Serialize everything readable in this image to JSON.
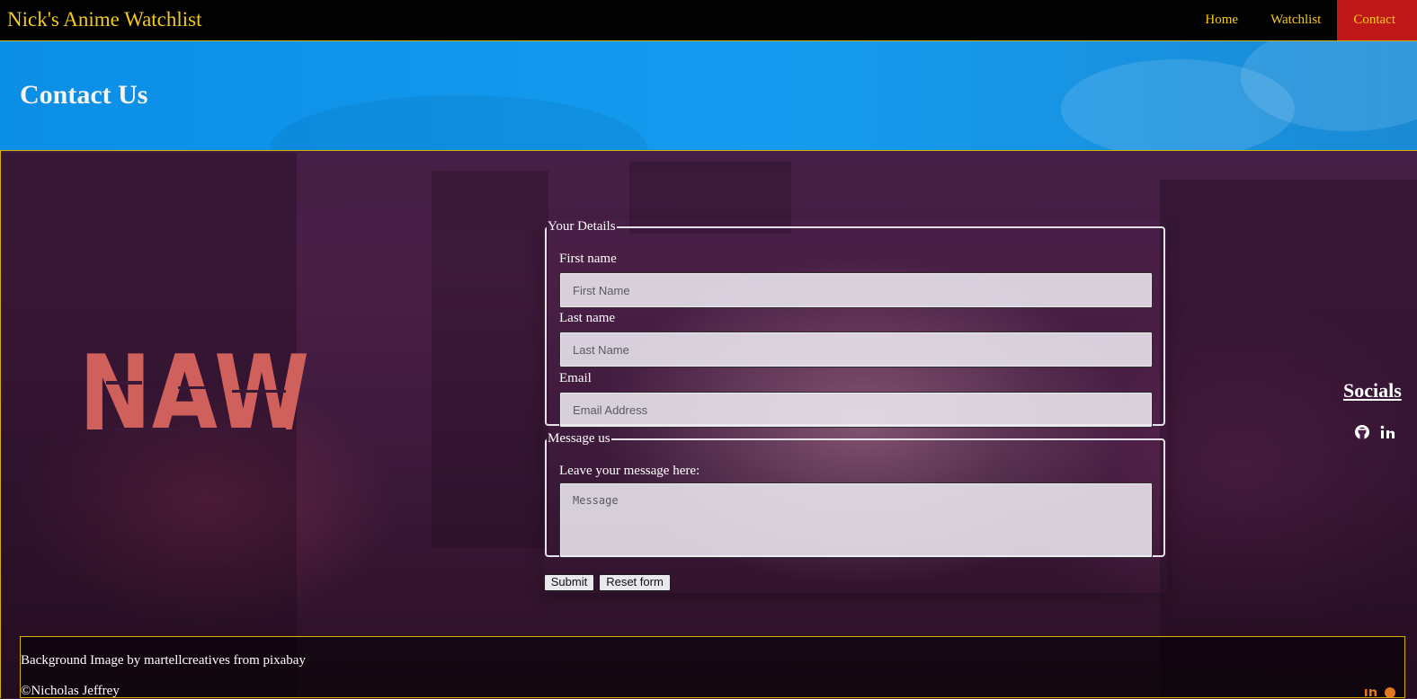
{
  "navbar": {
    "brand": "Nick's Anime Watchlist",
    "links": [
      {
        "label": "Home"
      },
      {
        "label": "Watchlist"
      },
      {
        "label": "Contact"
      }
    ]
  },
  "header": {
    "title": "Contact Us"
  },
  "logo": {
    "text": "NAW"
  },
  "form": {
    "details_legend": "Your Details",
    "first_name_label": "First name",
    "first_name_placeholder": "First Name",
    "last_name_label": "Last name",
    "last_name_placeholder": "Last Name",
    "email_label": "Email",
    "email_placeholder": "Email Address",
    "message_legend": "Message us",
    "message_label": "Leave your message here:",
    "message_placeholder": "Message",
    "submit_label": "Submit",
    "reset_label": "Reset form"
  },
  "socials": {
    "title": "Socials",
    "icons": [
      "github-icon",
      "linkedin-icon"
    ]
  },
  "footer": {
    "credit": "Background Image by martellcreatives from pixabay",
    "copyright": "©Nicholas Jeffrey"
  },
  "colors": {
    "nav_bg": "#020203",
    "brand": "#f3c91f",
    "active_tab": "#c01818",
    "header_blue": "#0b8ee6",
    "accent_border": "#d4b000",
    "logo_red": "#d0605c"
  }
}
